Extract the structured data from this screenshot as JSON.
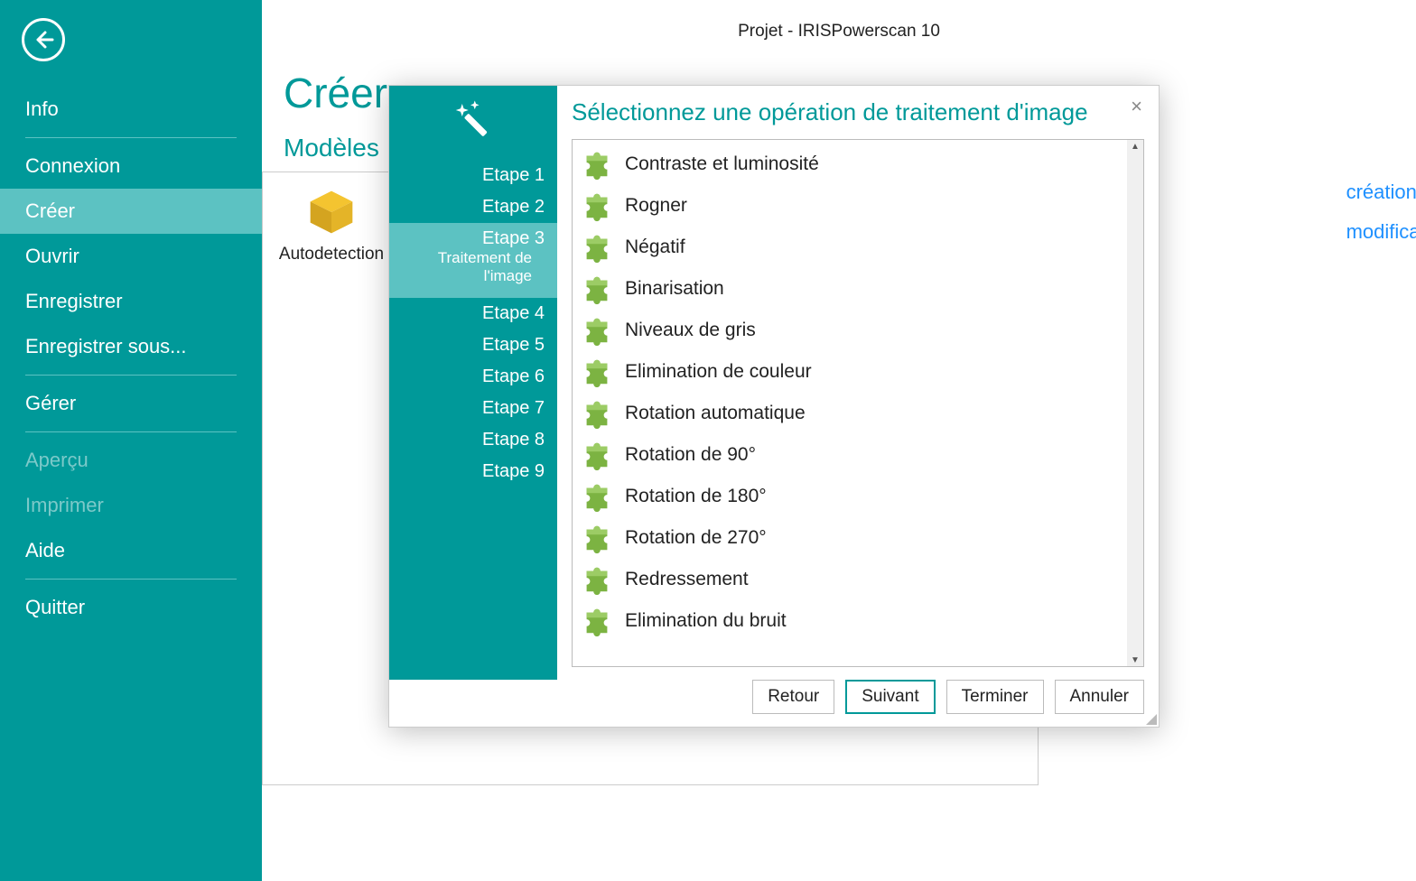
{
  "titlebar": "Projet - IRISPowerscan 10",
  "page_title": "Créer",
  "section_title": "Modèles",
  "template": {
    "label": "Autodetection"
  },
  "right_links": [
    "création",
    "modification"
  ],
  "sidebar": {
    "items": [
      {
        "label": "Info"
      },
      {
        "label": "Connexion"
      },
      {
        "label": "Créer"
      },
      {
        "label": "Ouvrir"
      },
      {
        "label": "Enregistrer"
      },
      {
        "label": "Enregistrer sous..."
      },
      {
        "label": "Gérer"
      },
      {
        "label": "Aperçu"
      },
      {
        "label": "Imprimer"
      },
      {
        "label": "Aide"
      },
      {
        "label": "Quitter"
      }
    ]
  },
  "wizard": {
    "title": "Sélectionnez une opération de traitement d'image",
    "steps": [
      {
        "label": "Etape 1"
      },
      {
        "label": "Etape 2"
      },
      {
        "label": "Etape 3",
        "sub": "Traitement de l'image"
      },
      {
        "label": "Etape 4"
      },
      {
        "label": "Etape 5"
      },
      {
        "label": "Etape 6"
      },
      {
        "label": "Etape 7"
      },
      {
        "label": "Etape 8"
      },
      {
        "label": "Etape 9"
      }
    ],
    "operations": [
      "Contraste et luminosité",
      "Rogner",
      "Négatif",
      "Binarisation",
      "Niveaux de gris",
      "Elimination de couleur",
      "Rotation automatique",
      "Rotation de 90°",
      "Rotation de 180°",
      "Rotation de 270°",
      "Redressement",
      "Elimination du bruit"
    ],
    "buttons": {
      "back": "Retour",
      "next": "Suivant",
      "finish": "Terminer",
      "cancel": "Annuler"
    }
  }
}
